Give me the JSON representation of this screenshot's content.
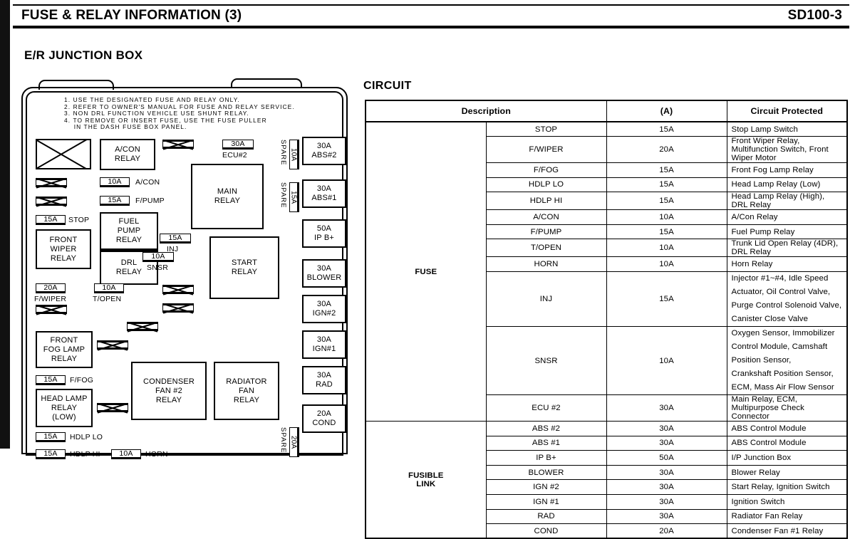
{
  "header": {
    "title": "FUSE & RELAY INFORMATION (3)",
    "page_code": "SD100-3"
  },
  "diagram": {
    "title": "E/R JUNCTION BOX",
    "notes": "1. USE THE DESIGNATED FUSE AND RELAY ONLY.\n2. REFER TO OWNER'S MANUAL FOR FUSE AND RELAY SERVICE.\n3. NON DRL FUNCTION VEHICLE USE SHUNT RELAY.\n4. TO REMOVE OR INSERT FUSE, USE THE FUSE PULLER\n    IN THE DASH FUSE BOX PANEL.",
    "relays": {
      "acon": "A/CON\nRELAY",
      "acon_l1": "A/CON",
      "acon_l2": "RELAY",
      "main_l1": "MAIN",
      "main_l2": "RELAY",
      "fuel_pump_l1": "FUEL",
      "fuel_pump_l2": "PUMP",
      "fuel_pump_l3": "RELAY",
      "drl_l1": "DRL",
      "drl_l2": "RELAY",
      "front_wiper_l1": "FRONT",
      "front_wiper_l2": "WIPER",
      "front_wiper_l3": "RELAY",
      "start_l1": "START",
      "start_l2": "RELAY",
      "front_fog_l1": "FRONT",
      "front_fog_l2": "FOG LAMP",
      "front_fog_l3": "RELAY",
      "head_lamp_l1": "HEAD LAMP",
      "head_lamp_l2": "RELAY",
      "head_lamp_l3": "(LOW)",
      "condenser_l1": "CONDENSER",
      "condenser_l2": "FAN #2",
      "condenser_l3": "RELAY",
      "radiator_l1": "RADIATOR",
      "radiator_l2": "FAN",
      "radiator_l3": "RELAY"
    },
    "fuses": {
      "acon_amp": "10A",
      "acon_name": "A/CON",
      "fpump_amp": "15A",
      "fpump_name": "F/PUMP",
      "stop_amp": "15A",
      "stop_name": "STOP",
      "ecu2_amp": "30A",
      "ecu2_name": "ECU#2",
      "inj_amp": "15A",
      "inj_name": "INJ",
      "snsr_amp": "10A",
      "snsr_name": "SNSR",
      "fwiper_amp": "20A",
      "fwiper_name": "F/WIPER",
      "topen_amp": "10A",
      "topen_name": "T/OPEN",
      "ffog_amp": "15A",
      "ffog_name": "F/FOG",
      "hdlplo_amp": "15A",
      "hdlplo_name": "HDLP LO",
      "hdlphi_amp": "15A",
      "hdlphi_name": "HDLP HI",
      "horn_amp": "10A",
      "horn_name": "HORN"
    },
    "links": {
      "abs2_l1": "30A",
      "abs2_l2": "ABS#2",
      "abs1_l1": "30A",
      "abs1_l2": "ABS#1",
      "ipb_l1": "50A",
      "ipb_l2": "IP B+",
      "blower_l1": "30A",
      "blower_l2": "BLOWER",
      "ign2_l1": "30A",
      "ign2_l2": "IGN#2",
      "ign1_l1": "30A",
      "ign1_l2": "IGN#1",
      "rad_l1": "30A",
      "rad_l2": "RAD",
      "cond_l1": "20A",
      "cond_l2": "COND"
    },
    "spares": {
      "label": "SPARE",
      "spare1_amp": "10A",
      "spare2_amp": "15A",
      "spare3_amp": "20A"
    }
  },
  "circuit": {
    "title": "CIRCUIT",
    "columns": [
      "Description",
      "(A)",
      "Circuit Protected"
    ],
    "sections": [
      {
        "category": "FUSE",
        "rows": [
          {
            "name": "STOP",
            "amp": "15A",
            "protected": [
              "Stop Lamp Switch"
            ]
          },
          {
            "name": "F/WIPER",
            "amp": "20A",
            "protected": [
              "Front Wiper Relay, Multifunction Switch, Front Wiper Motor"
            ]
          },
          {
            "name": "F/FOG",
            "amp": "15A",
            "protected": [
              "Front Fog Lamp Relay"
            ]
          },
          {
            "name": "HDLP LO",
            "amp": "15A",
            "protected": [
              "Head Lamp Relay (Low)"
            ]
          },
          {
            "name": "HDLP HI",
            "amp": "15A",
            "protected": [
              "Head Lamp Relay (High), DRL Relay"
            ]
          },
          {
            "name": "A/CON",
            "amp": "10A",
            "protected": [
              "A/Con Relay"
            ]
          },
          {
            "name": "F/PUMP",
            "amp": "15A",
            "protected": [
              "Fuel Pump Relay"
            ]
          },
          {
            "name": "T/OPEN",
            "amp": "10A",
            "protected": [
              "Trunk Lid Open Relay (4DR), DRL Relay"
            ]
          },
          {
            "name": "HORN",
            "amp": "10A",
            "protected": [
              "Horn Relay"
            ]
          },
          {
            "name": "INJ",
            "amp": "15A",
            "protected": [
              "Injector #1~#4, Idle Speed Actuator, Oil Control Valve,",
              "Purge Control Solenoid Valve, Canister Close Valve"
            ]
          },
          {
            "name": "SNSR",
            "amp": "10A",
            "protected": [
              "Oxygen Sensor, Immobilizer Control Module, Camshaft Position Sensor,",
              "Crankshaft Position Sensor, ECM, Mass Air Flow Sensor"
            ]
          },
          {
            "name": "ECU #2",
            "amp": "30A",
            "protected": [
              "Main Relay, ECM, Multipurpose Check Connector"
            ]
          }
        ]
      },
      {
        "category": "FUSIBLE LINK",
        "category_l1": "FUSIBLE",
        "category_l2": "LINK",
        "rows": [
          {
            "name": "ABS #2",
            "amp": "30A",
            "protected": [
              "ABS Control Module"
            ]
          },
          {
            "name": "ABS #1",
            "amp": "30A",
            "protected": [
              "ABS Control Module"
            ]
          },
          {
            "name": "IP B+",
            "amp": "50A",
            "protected": [
              "I/P Junction Box"
            ]
          },
          {
            "name": "BLOWER",
            "amp": "30A",
            "protected": [
              "Blower Relay"
            ]
          },
          {
            "name": "IGN #2",
            "amp": "30A",
            "protected": [
              "Start Relay, Ignition Switch"
            ]
          },
          {
            "name": "IGN #1",
            "amp": "30A",
            "protected": [
              "Ignition Switch"
            ]
          },
          {
            "name": "RAD",
            "amp": "30A",
            "protected": [
              "Radiator Fan Relay"
            ]
          },
          {
            "name": "COND",
            "amp": "20A",
            "protected": [
              "Condenser Fan #1 Relay"
            ]
          }
        ]
      }
    ]
  }
}
